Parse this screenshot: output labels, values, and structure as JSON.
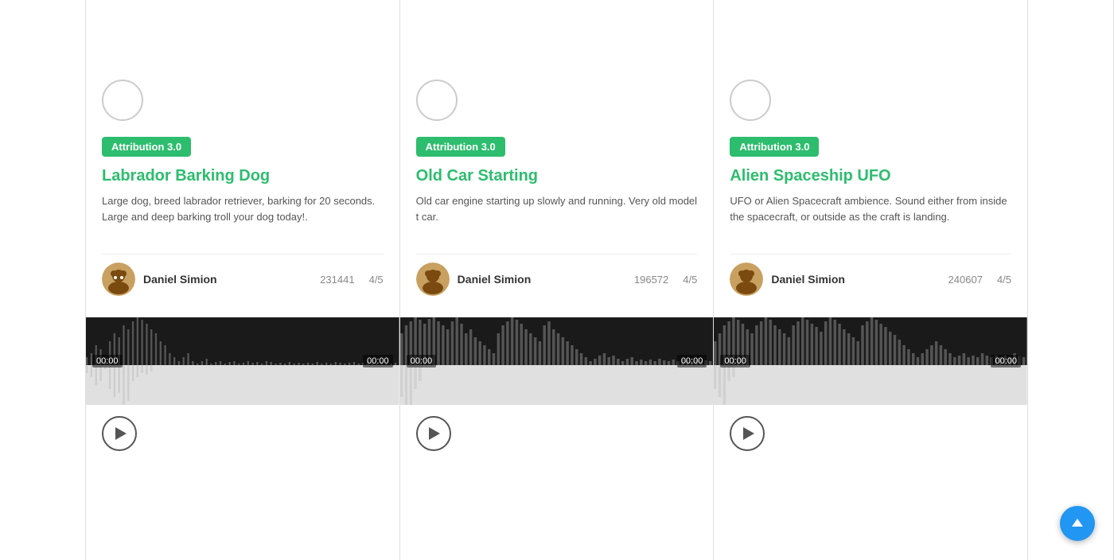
{
  "cards": [
    {
      "id": "card-1",
      "attribution": "Attribution 3.0",
      "title": "Labrador Barking Dog",
      "description": "Large dog, breed labrador retriever, barking for 20 seconds. Large and deep barking troll your dog today!.",
      "author": "Daniel Simion",
      "downloads": "231441",
      "rating": "4/5",
      "time_left": "00:00",
      "time_right": "00:00",
      "avatar_type": "dog"
    },
    {
      "id": "card-2",
      "attribution": "Attribution 3.0",
      "title": "Old Car Starting",
      "description": "Old car engine starting up slowly and running. Very old model t car.",
      "author": "Daniel Simion",
      "downloads": "196572",
      "rating": "4/5",
      "time_left": "00:00",
      "time_right": "00:00",
      "avatar_type": "cat"
    },
    {
      "id": "card-3",
      "attribution": "Attribution 3.0",
      "title": "Alien Spaceship UFO",
      "description": "UFO or Alien Spacecraft ambience. Sound either from inside the spacecraft, or outside as the craft is landing.",
      "author": "Daniel Simion",
      "downloads": "240607",
      "rating": "4/5",
      "time_left": "00:00",
      "time_right": "00:00",
      "avatar_type": "cat"
    }
  ],
  "scroll_top_label": "↑"
}
